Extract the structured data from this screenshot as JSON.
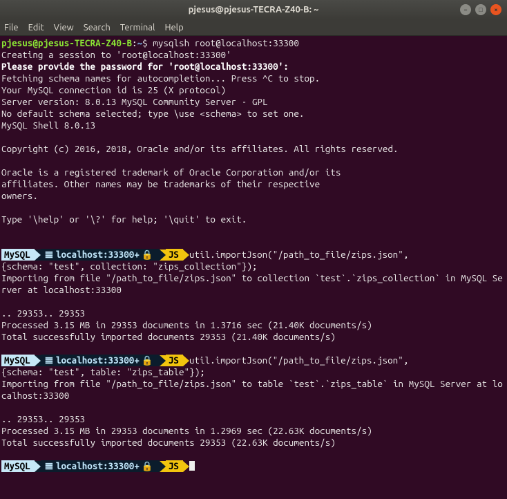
{
  "window": {
    "title": "pjesus@pjesus-TECRA-Z40-B: ~"
  },
  "menu": {
    "file": "File",
    "edit": "Edit",
    "view": "View",
    "search": "Search",
    "terminal": "Terminal",
    "help": "Help"
  },
  "shell_prompt": {
    "userhost": "pjesus@pjesus-TECRA-Z40-B",
    "sep": ":",
    "path": "~",
    "sym": "$",
    "cmd": "mysqlsh root@localhost:33300"
  },
  "session": {
    "l1": "Creating a session to 'root@localhost:33300'",
    "l2": "Please provide the password for 'root@localhost:33300':",
    "l3": "Fetching schema names for autocompletion... Press ^C to stop.",
    "l4": "Your MySQL connection id is 25 (X protocol)",
    "l5": "Server version: 8.0.13 MySQL Community Server - GPL",
    "l6": "No default schema selected; type \\use <schema> to set one.",
    "l7": "MySQL Shell 8.0.13",
    "l8": "Copyright (c) 2016, 2018, Oracle and/or its affiliates. All rights reserved.",
    "l9": "Oracle is a registered trademark of Oracle Corporation and/or its",
    "l10": "affiliates. Other names may be trademarks of their respective",
    "l11": "owners.",
    "l12": "Type '\\help' or '\\?' for help; '\\quit' to exit."
  },
  "prompt_segs": {
    "mysql": "MySQL",
    "host": "localhost:33300+",
    "js": "JS"
  },
  "cmd1": {
    "line1": "util.importJson(\"/path_to_file/zips.json\",",
    "line2": "{schema: \"test\", collection: \"zips_collection\"});",
    "out1": "Importing from file \"/path_to_file/zips.json\" to collection `test`.`zips_collection` in MySQL Server at localhost:33300",
    "out2": ".. 29353.. 29353",
    "out3": "Processed 3.15 MB in 29353 documents in 1.3716 sec (21.40K documents/s)",
    "out4": "Total successfully imported documents 29353 (21.40K documents/s)"
  },
  "cmd2": {
    "line1": "util.importJson(\"/path_to_file/zips.json\",",
    "line2": "{schema: \"test\", table: \"zips_table\"});",
    "out1": "Importing from file \"/path_to_file/zips.json\" to table `test`.`zips_table` in MySQL Server at localhost:33300",
    "out2": ".. 29353.. 29353",
    "out3": "Processed 3.15 MB in 29353 documents in 1.2969 sec (22.63K documents/s)",
    "out4": "Total successfully imported documents 29353 (22.63K documents/s)"
  }
}
